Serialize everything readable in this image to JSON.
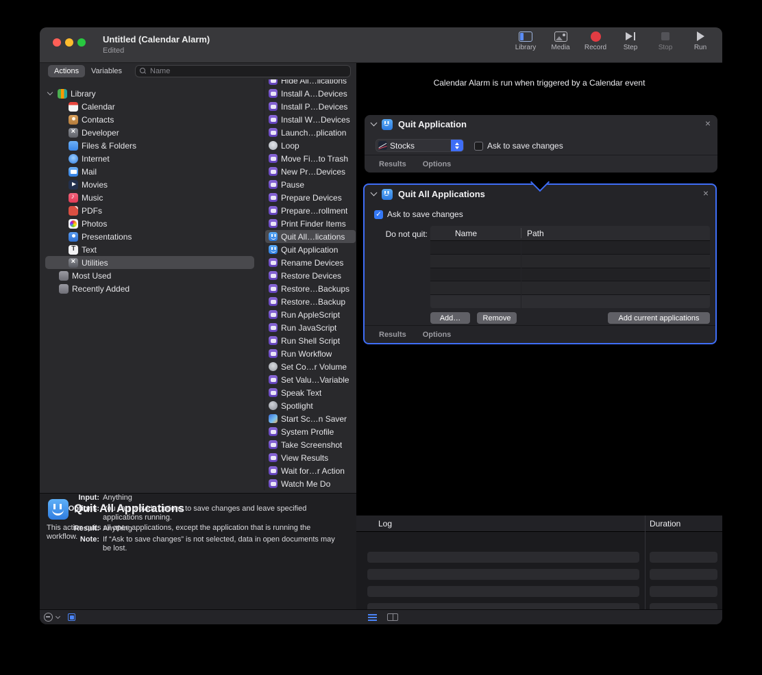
{
  "window": {
    "title": "Untitled (Calendar Alarm)",
    "subtitle": "Edited"
  },
  "toolbar": [
    {
      "label": "Library",
      "icon": "tb-library",
      "name": "library-toolbar-button"
    },
    {
      "label": "Media",
      "icon": "tb-media",
      "name": "media-toolbar-button"
    },
    {
      "label": "Record",
      "icon": "tb-record",
      "name": "record-button"
    },
    {
      "label": "Step",
      "icon": "tb-step",
      "name": "step-button"
    },
    {
      "label": "Stop",
      "icon": "tb-stop",
      "name": "stop-button",
      "disabled": true
    },
    {
      "label": "Run",
      "icon": "tb-run",
      "name": "run-button"
    }
  ],
  "filter": {
    "actions_tab": "Actions",
    "variables_tab": "Variables",
    "search_placeholder": "Name"
  },
  "sidebar": {
    "root_label": "Library",
    "items": [
      {
        "label": "Calendar",
        "icon": "calendar-icon",
        "name": "sidebar-item-calendar"
      },
      {
        "label": "Contacts",
        "icon": "contacts-icon",
        "name": "sidebar-item-contacts"
      },
      {
        "label": "Developer",
        "icon": "developer-icon",
        "name": "sidebar-item-developer"
      },
      {
        "label": "Files & Folders",
        "icon": "folders-icon",
        "name": "sidebar-item-files-folders"
      },
      {
        "label": "Internet",
        "icon": "internet-icon",
        "name": "sidebar-item-internet"
      },
      {
        "label": "Mail",
        "icon": "mail-icon",
        "name": "sidebar-item-mail"
      },
      {
        "label": "Movies",
        "icon": "movies-icon",
        "name": "sidebar-item-movies"
      },
      {
        "label": "Music",
        "icon": "music-icon",
        "name": "sidebar-item-music"
      },
      {
        "label": "PDFs",
        "icon": "pdfs-icon",
        "name": "sidebar-item-pdfs"
      },
      {
        "label": "Photos",
        "icon": "photos-icon",
        "name": "sidebar-item-photos"
      },
      {
        "label": "Presentations",
        "icon": "presentations-icon",
        "name": "sidebar-item-presentations"
      },
      {
        "label": "Text",
        "icon": "text-icon",
        "name": "sidebar-item-text"
      },
      {
        "label": "Utilities",
        "icon": "utilities-icon",
        "name": "sidebar-item-utilities",
        "selected": true
      }
    ],
    "extra_items": [
      {
        "label": "Most Used",
        "icon": "smart-folder-icon",
        "name": "sidebar-item-most-used"
      },
      {
        "label": "Recently Added",
        "icon": "smart-folder-icon",
        "name": "sidebar-item-recently-added"
      }
    ]
  },
  "actions_list": [
    {
      "label": "Hide All…lications",
      "icon": "automator-action-icon"
    },
    {
      "label": "Install A…Devices",
      "icon": "automator-action-icon"
    },
    {
      "label": "Install P…Devices",
      "icon": "automator-action-icon"
    },
    {
      "label": "Install W…Devices",
      "icon": "automator-action-icon"
    },
    {
      "label": "Launch…plication",
      "icon": "automator-action-icon"
    },
    {
      "label": "Loop",
      "icon": "loop-icon"
    },
    {
      "label": "Move Fi…to Trash",
      "icon": "automator-action-icon"
    },
    {
      "label": "New Pr…Devices",
      "icon": "automator-action-icon"
    },
    {
      "label": "Pause",
      "icon": "automator-action-icon"
    },
    {
      "label": "Prepare Devices",
      "icon": "automator-action-icon"
    },
    {
      "label": "Prepare…rollment",
      "icon": "automator-action-icon"
    },
    {
      "label": "Print Finder Items",
      "icon": "automator-action-icon"
    },
    {
      "label": "Quit All…lications",
      "icon": "finder-icon",
      "selected": true
    },
    {
      "label": "Quit Application",
      "icon": "finder-icon"
    },
    {
      "label": "Rename Devices",
      "icon": "automator-action-icon"
    },
    {
      "label": "Restore Devices",
      "icon": "automator-action-icon"
    },
    {
      "label": "Restore…Backups",
      "icon": "automator-action-icon"
    },
    {
      "label": "Restore…Backup",
      "icon": "automator-action-icon"
    },
    {
      "label": "Run AppleScript",
      "icon": "automator-action-icon"
    },
    {
      "label": "Run JavaScript",
      "icon": "automator-action-icon"
    },
    {
      "label": "Run Shell Script",
      "icon": "automator-action-icon"
    },
    {
      "label": "Run Workflow",
      "icon": "automator-action-icon"
    },
    {
      "label": "Set Co…r Volume",
      "icon": "volume-icon"
    },
    {
      "label": "Set Valu…Variable",
      "icon": "automator-action-icon"
    },
    {
      "label": "Speak Text",
      "icon": "automator-action-icon"
    },
    {
      "label": "Spotlight",
      "icon": "spotlight-icon"
    },
    {
      "label": "Start Sc…n Saver",
      "icon": "screensaver-icon"
    },
    {
      "label": "System Profile",
      "icon": "automator-action-icon"
    },
    {
      "label": "Take Screenshot",
      "icon": "automator-action-icon"
    },
    {
      "label": "View Results",
      "icon": "automator-action-icon"
    },
    {
      "label": "Wait for…r Action",
      "icon": "automator-action-icon"
    },
    {
      "label": "Watch Me Do",
      "icon": "automator-action-icon"
    }
  ],
  "workflow": {
    "header": "Calendar Alarm is run when triggered by a Calendar event",
    "card1": {
      "title": "Quit Application",
      "app_dropdown_value": "Stocks",
      "checkbox_label": "Ask to save changes",
      "checkbox_checked": false,
      "footer": [
        "Results",
        "Options"
      ]
    },
    "card2": {
      "title": "Quit All Applications",
      "checkbox_label": "Ask to save changes",
      "checkbox_checked": true,
      "do_not_quit_label": "Do not quit:",
      "table_headers": [
        "Name",
        "Path"
      ],
      "add_button": "Add…",
      "remove_button": "Remove",
      "add_current_button": "Add current applications",
      "footer": [
        "Results",
        "Options"
      ]
    }
  },
  "description": {
    "title": "Quit All Applications",
    "body": "This action quits all open applications, except the application that is running the workflow.",
    "rows": [
      {
        "label": "Input:",
        "value": "Anything"
      },
      {
        "label": "Options:",
        "value": "You can provide options to save changes and leave specified applications running."
      },
      {
        "label": "Result:",
        "value": "Anything"
      },
      {
        "label": "Note:",
        "value": "If “Ask to save changes” is not selected, data in open documents may be lost."
      }
    ]
  },
  "log": {
    "headers": [
      "Log",
      "Duration"
    ]
  },
  "colors": {
    "accent_blue": "#3f6ef7",
    "selection_highlight": "#49494d",
    "record_red": "#e23c43"
  }
}
